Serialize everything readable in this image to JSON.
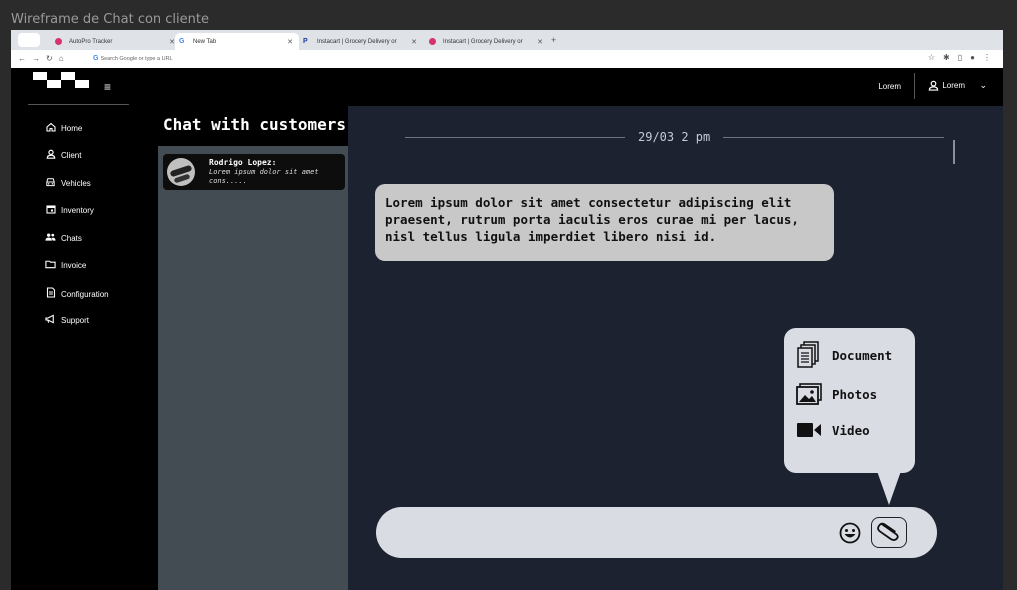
{
  "frame": {
    "title": "Wireframe de Chat con cliente"
  },
  "browser": {
    "tabs": [
      {
        "label": "AutoPro Tracker",
        "active": false
      },
      {
        "label": "New Tab",
        "active": true
      },
      {
        "label": "Instacart | Grocery Delivery or",
        "active": false
      },
      {
        "label": "Instacart | Grocery Delivery or",
        "active": false
      }
    ],
    "address_placeholder": "Search Google or type a URL"
  },
  "header": {
    "lorem_label": "Lorem",
    "user_label": "Lorem"
  },
  "sidebar": {
    "items": [
      {
        "label": "Home",
        "icon": "home-icon"
      },
      {
        "label": "Client",
        "icon": "user-icon"
      },
      {
        "label": "Vehicles",
        "icon": "car-icon"
      },
      {
        "label": "Inventory",
        "icon": "calendar-icon"
      },
      {
        "label": "Chats",
        "icon": "group-icon"
      },
      {
        "label": "Invoice",
        "icon": "folder-icon"
      },
      {
        "label": "Configuration",
        "icon": "document-icon"
      },
      {
        "label": "Support",
        "icon": "megaphone-icon"
      }
    ]
  },
  "conversations": {
    "title": "Chat with customers",
    "items": [
      {
        "name": "Rodrigo Lopez:",
        "preview": "Lorem ipsum dolor sit amet cons....."
      }
    ]
  },
  "chat": {
    "date_divider": "29/03 2 pm",
    "messages": [
      {
        "text": "Lorem ipsum dolor sit amet consectetur adipiscing elit praesent, rutrum porta iaculis eros curae mi per lacus, nisl tellus ligula imperdiet libero nisi id."
      }
    ],
    "attach_menu": [
      {
        "label": "Document",
        "icon": "document-stack-icon"
      },
      {
        "label": "Photos",
        "icon": "photos-icon"
      },
      {
        "label": "Video",
        "icon": "video-camera-icon"
      }
    ]
  },
  "colors": {
    "app_bg": "#000000",
    "chat_bg": "#1d2230",
    "conv_list_bg": "#434c52",
    "bubble": "#c8c8c8",
    "composer": "#d9dde3",
    "tab_dot": "#d6336c"
  }
}
